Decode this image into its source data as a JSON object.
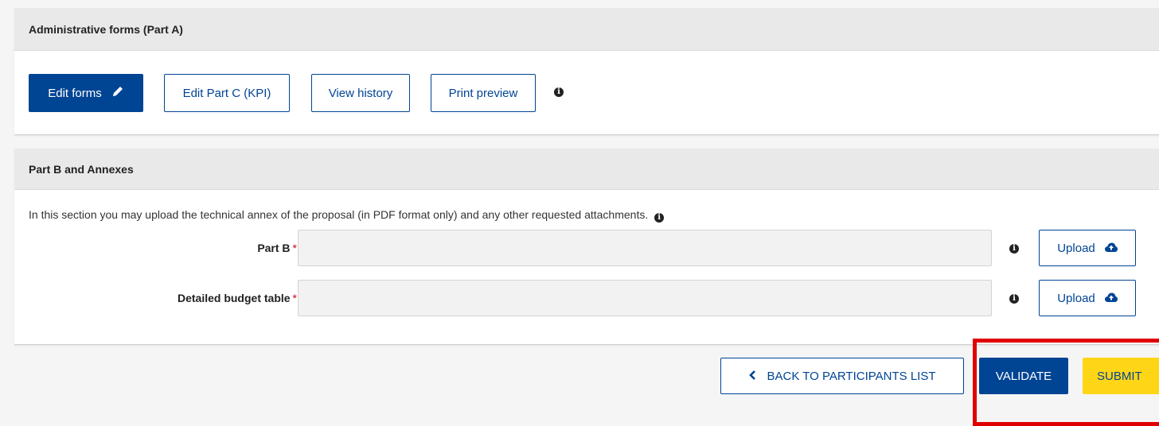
{
  "part_a": {
    "title": "Administrative forms (Part A)",
    "edit_forms_label": "Edit forms",
    "edit_part_c_label": "Edit Part C (KPI)",
    "view_history_label": "View history",
    "print_preview_label": "Print preview"
  },
  "part_b": {
    "title": "Part B and Annexes",
    "description": "In this section you may upload the technical annex of the proposal (in PDF format only) and any other requested attachments.",
    "fields": [
      {
        "label": "Part B",
        "value": "",
        "upload_label": "Upload"
      },
      {
        "label": "Detailed budget table",
        "value": "",
        "upload_label": "Upload"
      }
    ]
  },
  "footer": {
    "back_label": "BACK TO PARTICIPANTS LIST",
    "validate_label": "VALIDATE",
    "submit_label": "SUBMIT"
  },
  "colors": {
    "primary": "#004494",
    "submit": "#ffd617",
    "required": "#d0021b",
    "highlight": "#e00000"
  }
}
